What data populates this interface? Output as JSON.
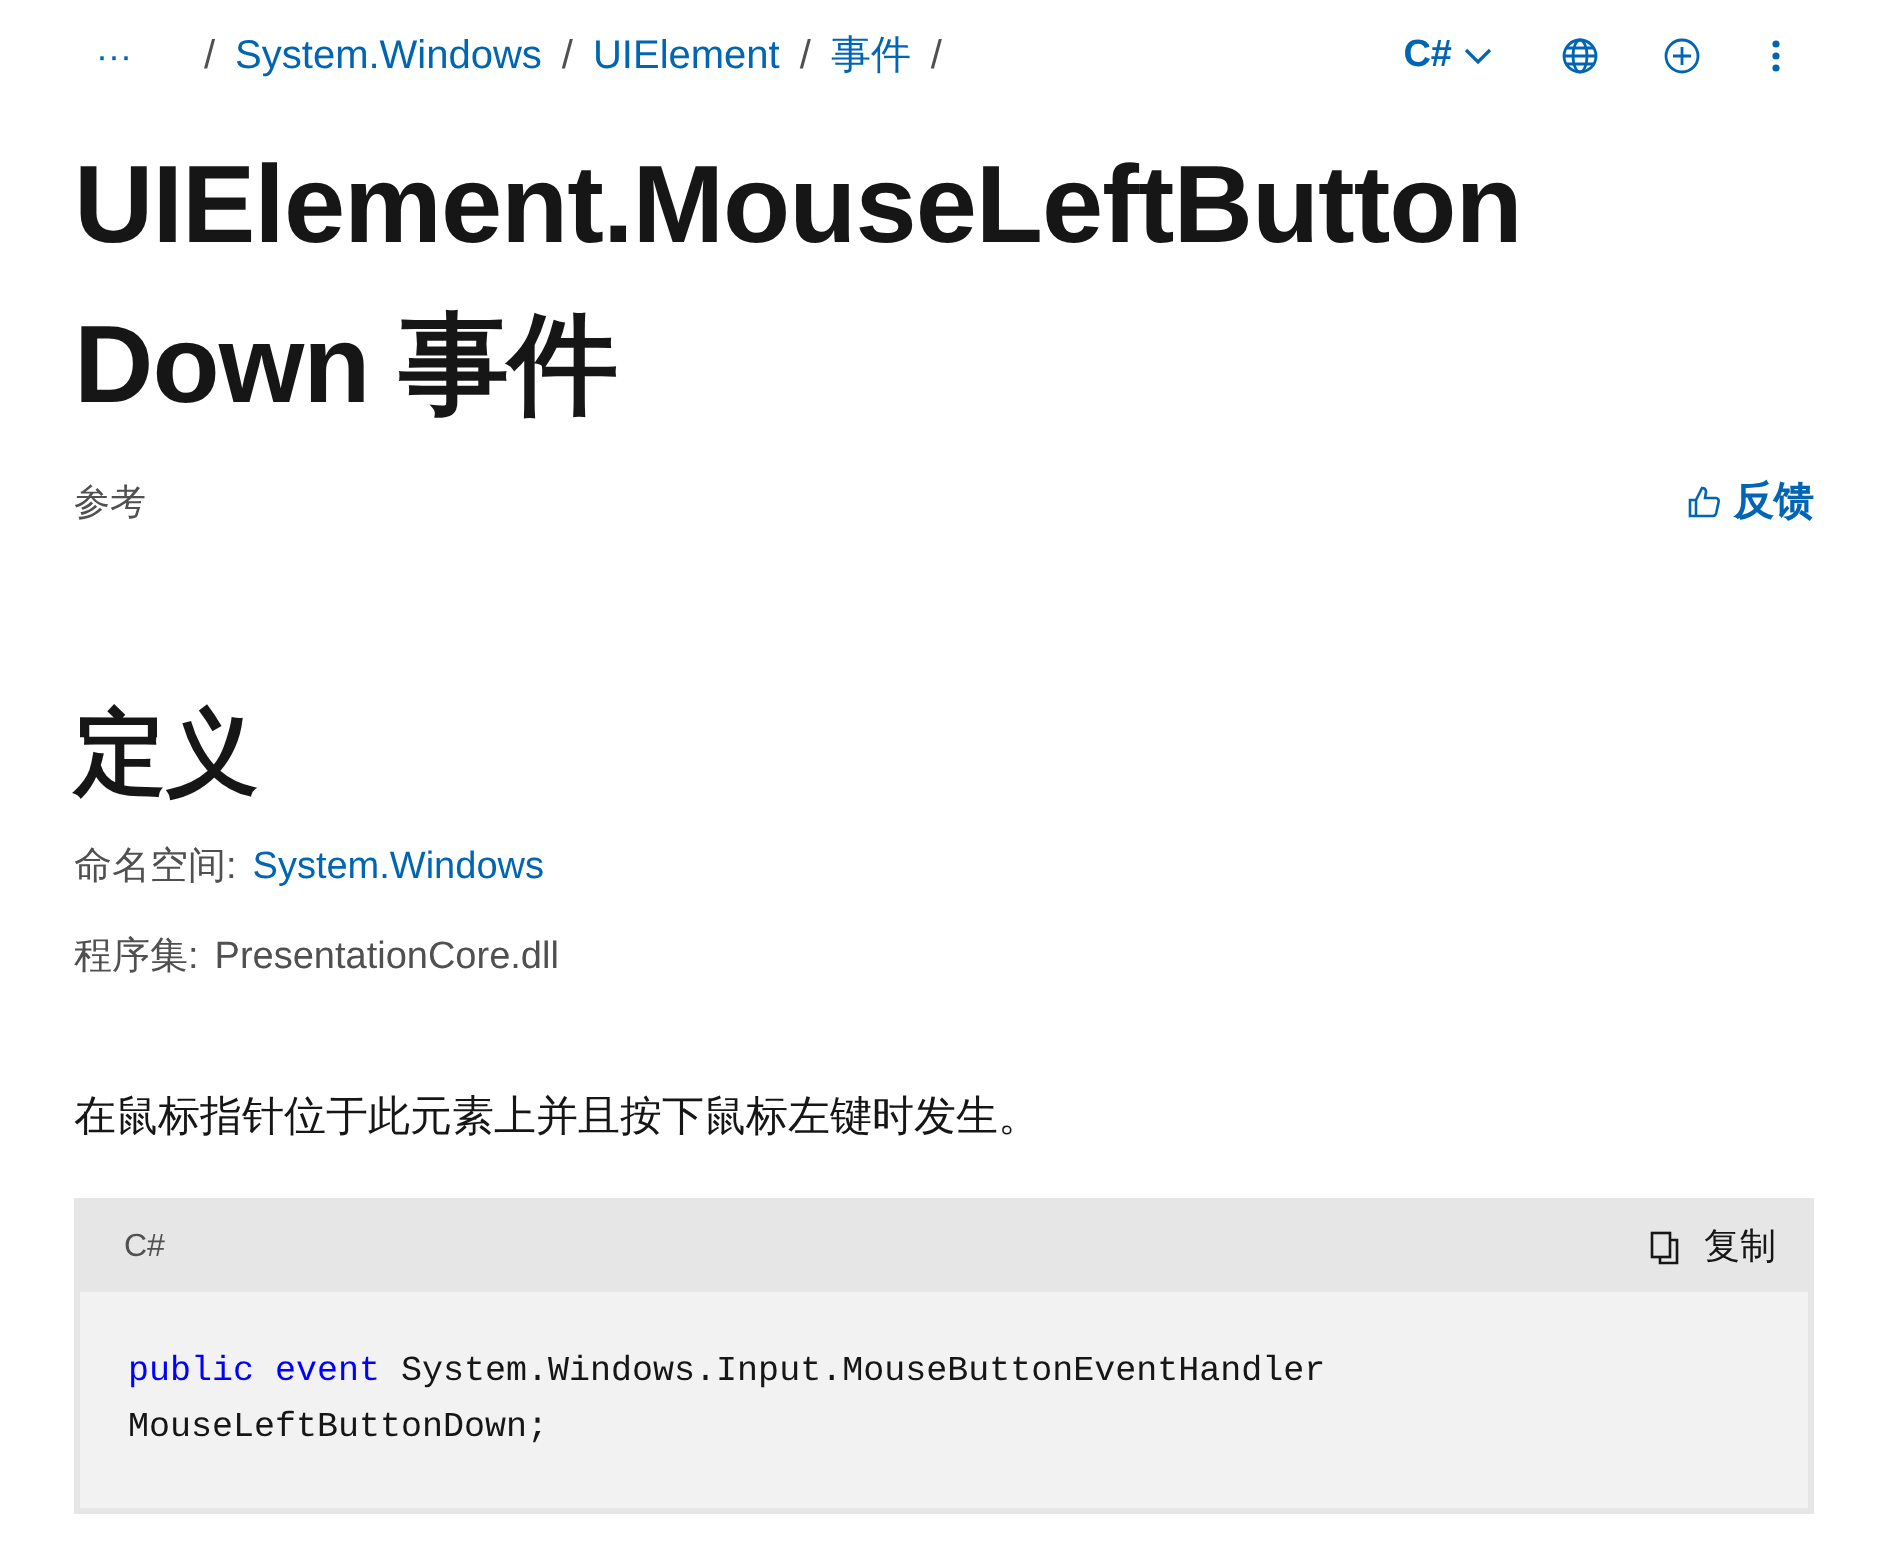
{
  "breadcrumb": {
    "more": "···",
    "separator": "/",
    "items": [
      "System.Windows",
      "UIElement",
      "事件"
    ]
  },
  "toolbar": {
    "language": "C#"
  },
  "title": "UIElement.MouseLeftButtonDown 事件",
  "subtitle": "参考",
  "feedback": "反馈",
  "section_heading": "定义",
  "meta": [
    {
      "label": "命名空间:",
      "value": "System.Windows",
      "link": true
    },
    {
      "label": "程序集:",
      "value": "PresentationCore.dll",
      "link": false
    }
  ],
  "description": "在鼠标指针位于此元素上并且按下鼠标左键时发生。",
  "code_block": {
    "language": "C#",
    "copy": "复制",
    "lines": [
      [
        {
          "kind": "keyword",
          "text": "public "
        },
        {
          "kind": "keyword",
          "text": "event"
        },
        {
          "kind": "plain",
          "text": " System.Windows.Input.MouseButtonEventHandler"
        }
      ],
      [
        {
          "kind": "plain",
          "text": "MouseLeftButtonDown;"
        }
      ]
    ]
  }
}
